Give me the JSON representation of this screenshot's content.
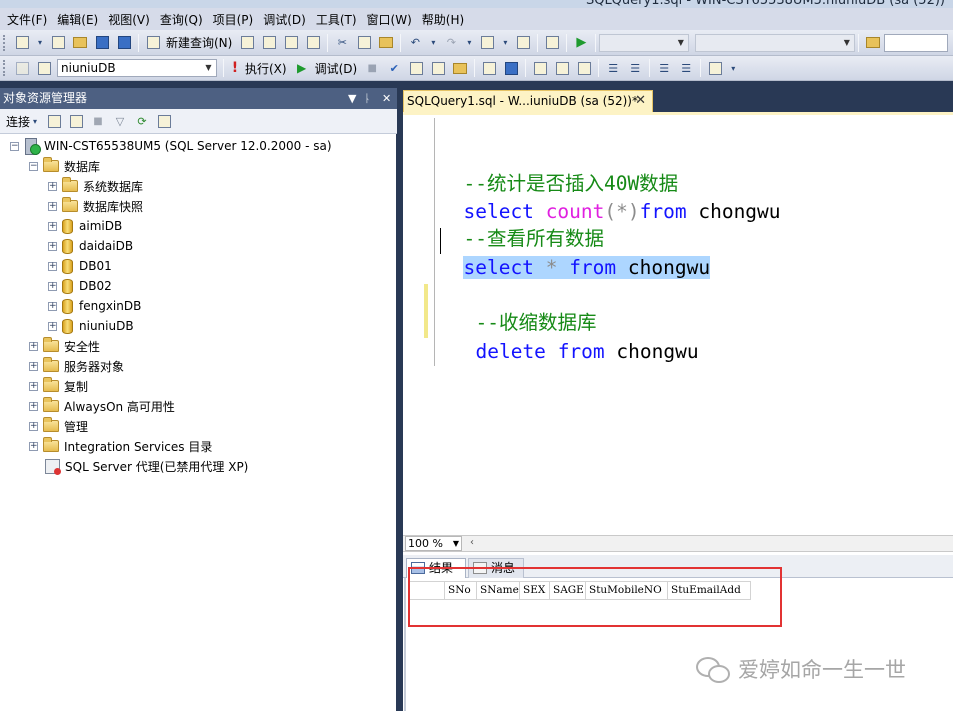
{
  "window": {
    "title": "SQLQuery1.sql - WIN-CST65538UM5.niuniuDB (sa (52))"
  },
  "menu": [
    "文件(F)",
    "编辑(E)",
    "视图(V)",
    "查询(Q)",
    "项目(P)",
    "调试(D)",
    "工具(T)",
    "窗口(W)",
    "帮助(H)"
  ],
  "toolbar1": {
    "new_query_label": "新建查询(N)"
  },
  "toolbar2": {
    "database": "niuniuDB",
    "execute_label": "执行(X)",
    "debug_label": "调试(D)"
  },
  "object_explorer": {
    "title": "对象资源管理器",
    "pin": "▾ ⊓ ✕",
    "connect_label": "连接",
    "server": "WIN-CST65538UM5 (SQL Server 12.0.2000 - sa)",
    "databases_label": "数据库",
    "db_children": [
      {
        "name": "系统数据库",
        "kind": "folder"
      },
      {
        "name": "数据库快照",
        "kind": "folder"
      },
      {
        "name": "aimiDB",
        "kind": "db"
      },
      {
        "name": "daidaiDB",
        "kind": "db"
      },
      {
        "name": "DB01",
        "kind": "db"
      },
      {
        "name": "DB02",
        "kind": "db"
      },
      {
        "name": "fengxinDB",
        "kind": "db"
      },
      {
        "name": "niuniuDB",
        "kind": "db"
      }
    ],
    "server_children": [
      "安全性",
      "服务器对象",
      "复制",
      "AlwaysOn 高可用性",
      "管理",
      "Integration Services 目录"
    ],
    "agent_label": "SQL Server 代理(已禁用代理 XP)"
  },
  "editor": {
    "tab_label": "SQLQuery1.sql - W...iuniuDB (sa (52))*",
    "lines": {
      "comment1": "--统计是否插入40W数据",
      "count_kw_select": "select",
      "count_fn": "count",
      "count_arg": "(*)",
      "count_kw_from": "from",
      "count_table": "chongwu",
      "comment2": "--查看所有数据",
      "sel_kw_select": "select",
      "sel_star": "*",
      "sel_kw_from": "from",
      "sel_table": "chongwu",
      "comment3": "--收缩数据库",
      "del_kw_delete": "delete",
      "del_kw_from": "from",
      "del_table": "chongwu"
    }
  },
  "zoom": "100 %",
  "results": {
    "tabs": {
      "results": "结果",
      "messages": "消息"
    },
    "columns": [
      "SNo",
      "SName",
      "SEX",
      "SAGE",
      "StuMobileNO",
      "StuEmailAdd"
    ]
  },
  "watermark": "爱婷如命一生一世"
}
